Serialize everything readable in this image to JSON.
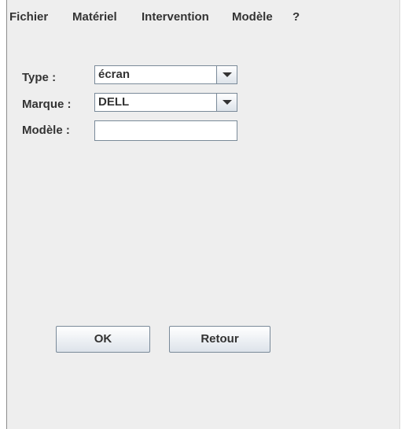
{
  "menubar": {
    "items": [
      "Fichier",
      "Matériel",
      "Intervention",
      "Modèle",
      "?"
    ]
  },
  "form": {
    "type_label": "Type :",
    "type_value": "écran",
    "marque_label": "Marque :",
    "marque_value": "DELL",
    "modele_label": "Modèle :",
    "modele_value": ""
  },
  "buttons": {
    "ok_label": "OK",
    "retour_label": "Retour"
  },
  "icons": {
    "combo_arrow": "chevron-down-icon"
  }
}
